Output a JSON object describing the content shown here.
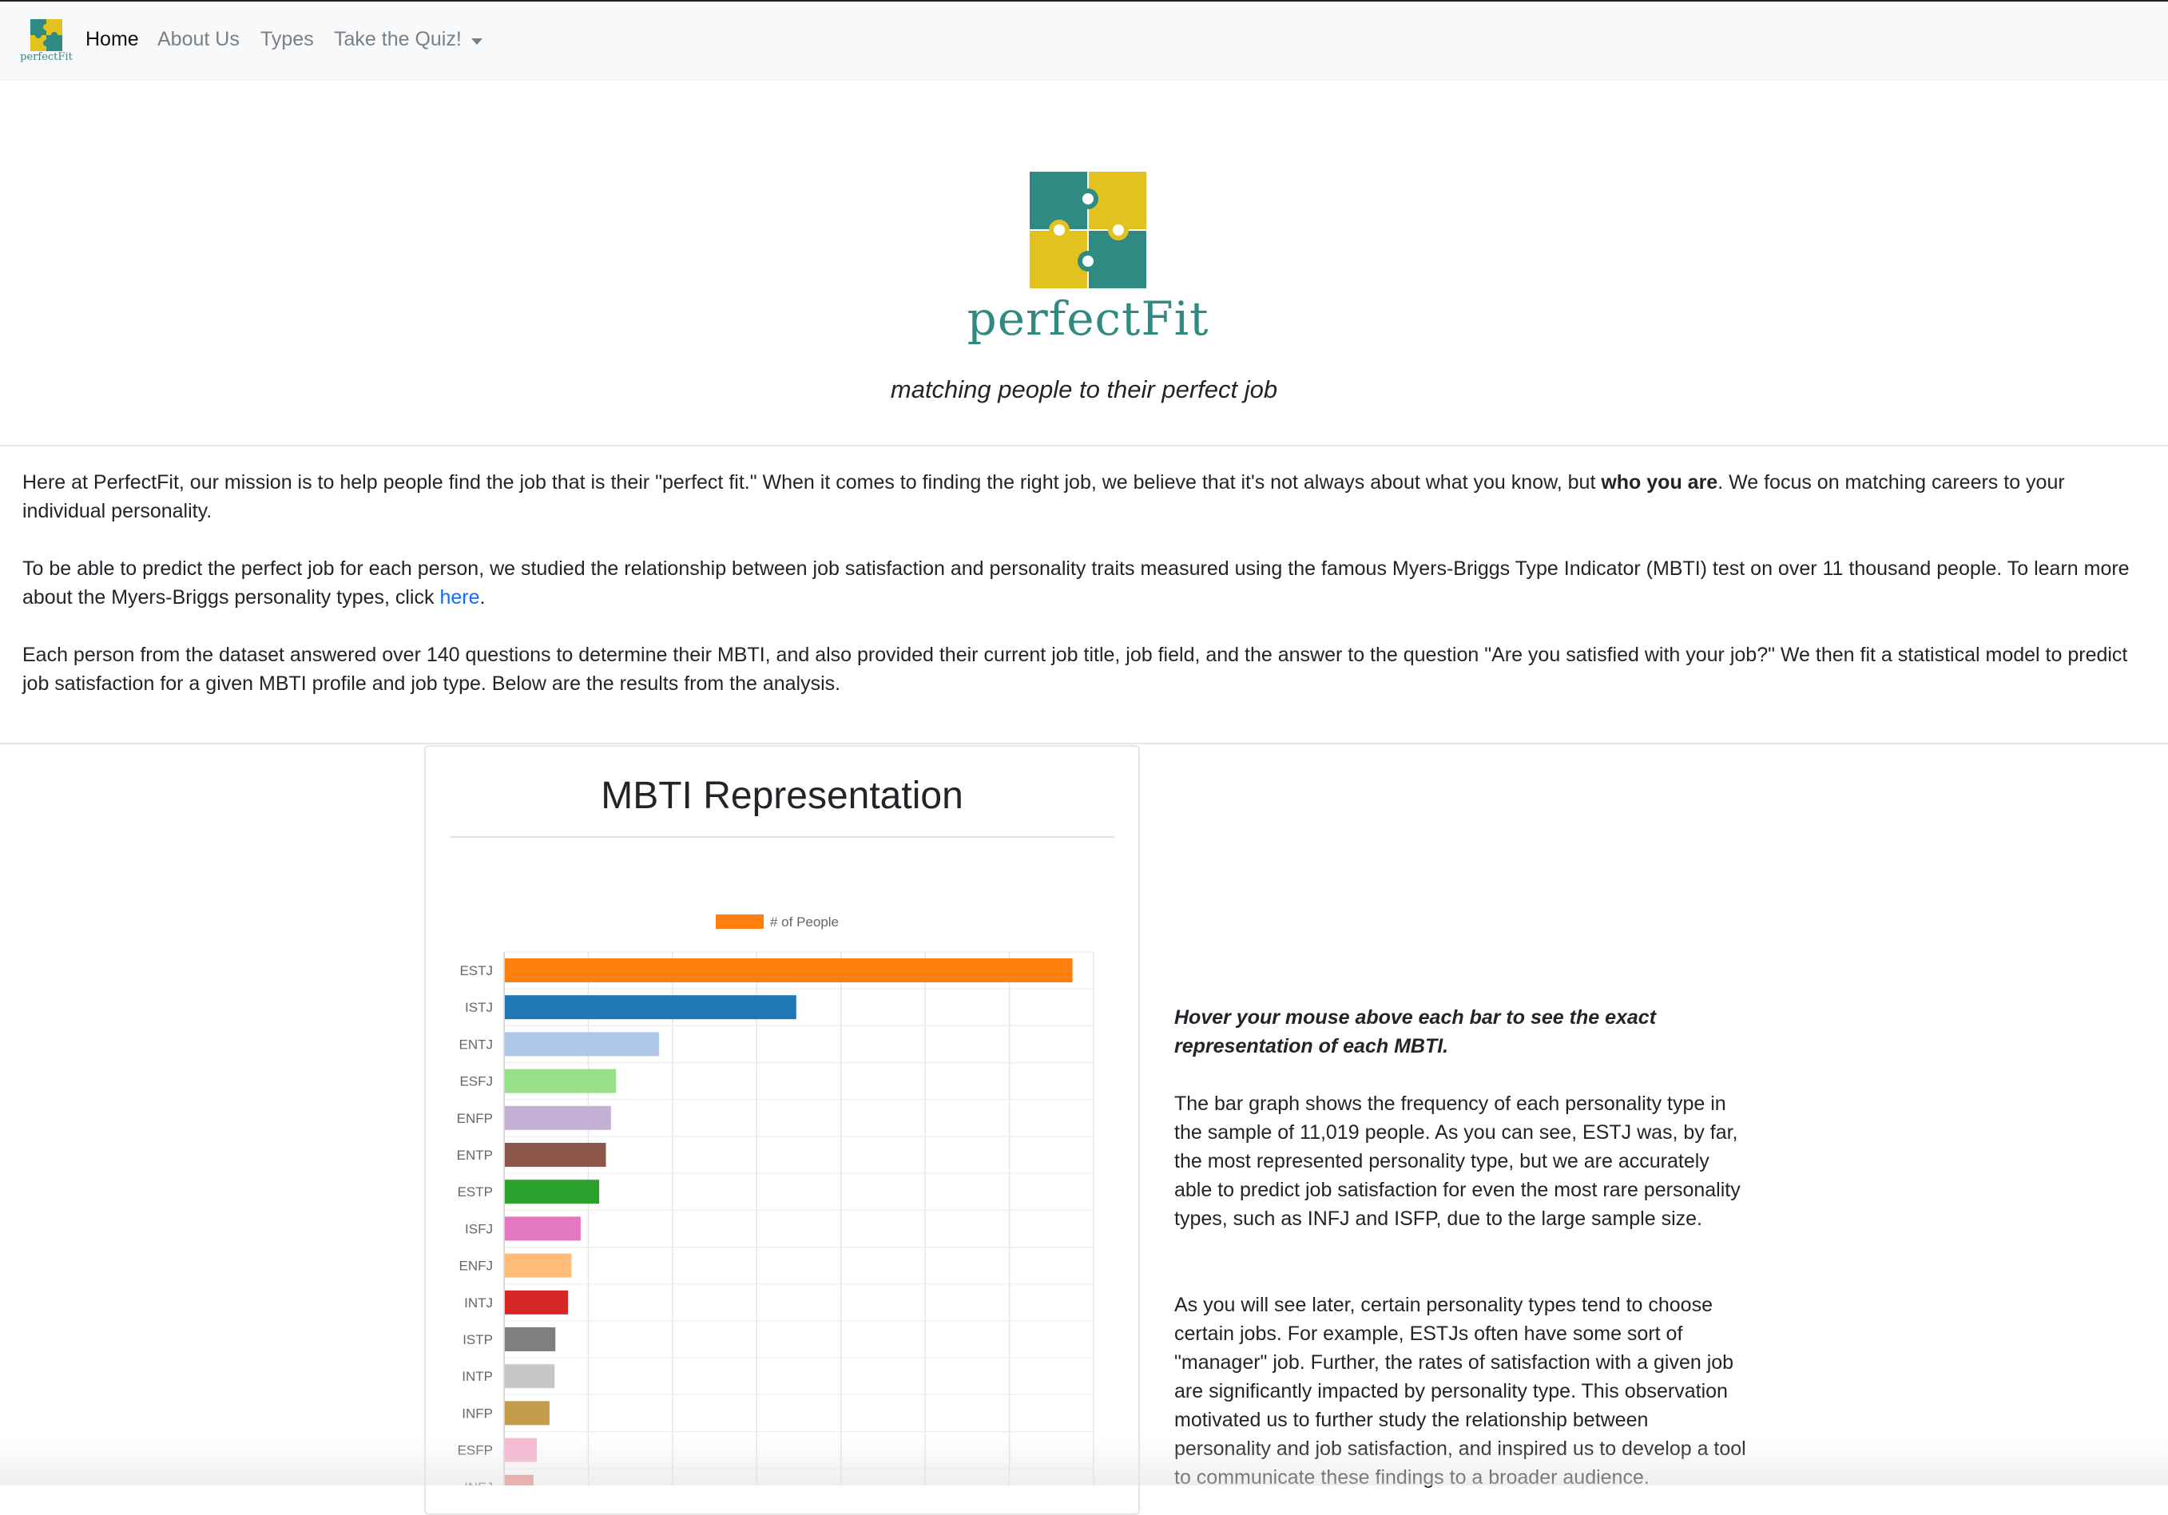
{
  "navbar": {
    "brand_text": "perfectFit",
    "items": [
      {
        "label": "Home",
        "active": true
      },
      {
        "label": "About Us",
        "active": false
      },
      {
        "label": "Types",
        "active": false
      },
      {
        "label": "Take the Quiz!",
        "active": false,
        "dropdown": true
      }
    ]
  },
  "hero": {
    "logo_text": "perfectFit",
    "tagline": "matching people to their perfect job"
  },
  "intro": {
    "p1_start": "Here at PerfectFit, our mission is to help people find the job that is their \"perfect fit.\" When it comes to finding the right job, we believe that it's not always about what you know, but ",
    "p1_bold": "who you are",
    "p1_end": ". We focus on matching careers to your individual personality.",
    "p2_start": "To be able to predict the perfect job for each person, we studied the relationship between job satisfaction and personality traits measured using the famous Myers-Briggs Type Indicator (MBTI) test on over 11 thousand people. To learn more about the Myers-Briggs personality types, click ",
    "p2_link": "here",
    "p2_end": ".",
    "p3": "Each person from the dataset answered over 140 questions to determine their MBTI, and also provided their current job title, job field, and the answer to the question \"Are you satisfied with your job?\" We then fit a statistical model to predict job satisfaction for a given MBTI profile and job type. Below are the results from the analysis."
  },
  "card": {
    "title": "MBTI Representation"
  },
  "side": {
    "hint": "Hover your mouse above each bar to see the exact representation of each MBTI.",
    "p1": "The bar graph shows the frequency of each personality type in the sample of 11,019 people. As you can see, ESTJ was, by far, the most represented personality type, but we are accurately able to predict job satisfaction for even the most rare personality types, such as INFJ and ISFP, due to the large sample size.",
    "p2": "As you will see later, certain personality types tend to choose certain jobs. For example, ESTJs often have some sort of \"manager\" job. Further, the rates of satisfaction with a given job are significantly impacted by personality type. This observation motivated us to further study the relationship between personality and job satisfaction, and inspired us to develop a tool to communicate these findings to a broader audience."
  },
  "colors": {
    "teal": "#2f8a82",
    "gold": "#e2c21f",
    "link": "#0d6efd"
  },
  "chart_data": {
    "type": "bar",
    "orientation": "horizontal",
    "title": "",
    "legend": [
      "# of People"
    ],
    "legend_position": "top",
    "grid": true,
    "categories": [
      "ESTJ",
      "ISTJ",
      "ENTJ",
      "ESFJ",
      "ENFP",
      "ENTP",
      "ESTP",
      "ISFJ",
      "ENFJ",
      "INTJ",
      "ISTP",
      "INTP",
      "INFP",
      "ESFP",
      "INFJ"
    ],
    "series": [
      {
        "name": "# of People",
        "values": [
          3370,
          1730,
          915,
          660,
          630,
          600,
          560,
          450,
          395,
          375,
          300,
          295,
          265,
          190,
          170
        ]
      }
    ],
    "colors": [
      "#ff7f0e",
      "#1f77b4",
      "#aec7e8",
      "#98df8a",
      "#c5b0d5",
      "#8c564b",
      "#2ca02c",
      "#e377c2",
      "#ffbb78",
      "#d62728",
      "#7f7f7f",
      "#c7c7c7",
      "#c49c4a",
      "#f7b6d2",
      "#f08080"
    ],
    "xlim": [
      0,
      3500
    ]
  }
}
